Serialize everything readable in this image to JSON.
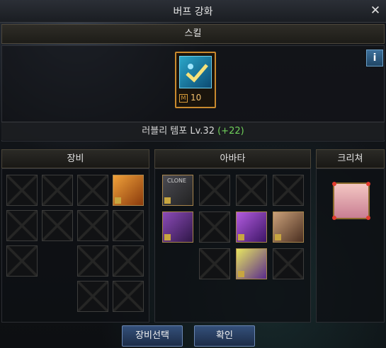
{
  "window": {
    "title": "버프 강화",
    "close_icon": "close-icon"
  },
  "skill": {
    "header": "스킬",
    "icon": "skill-icon",
    "level_badge": "M",
    "level": "10",
    "name_line": "러블리 템포 Lv.32",
    "bonus": "(+22)",
    "info_label": "i"
  },
  "panels": {
    "equipment": {
      "title": "장비"
    },
    "avatar": {
      "title": "아바타",
      "clone_label": "CLONE"
    },
    "creature": {
      "title": "크리쳐"
    }
  },
  "buttons": {
    "select_equipment": "장비선택",
    "confirm": "확인"
  },
  "colors": {
    "accent_orange": "#c98a2e",
    "bonus_green": "#6fd05a",
    "button_blue": "#34507a"
  }
}
